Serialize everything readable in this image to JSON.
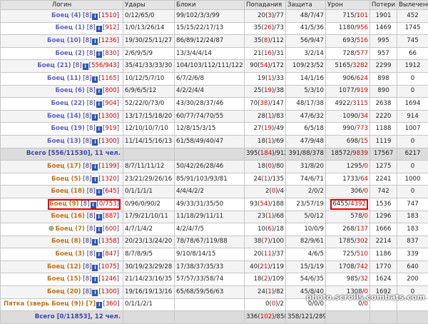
{
  "headers": {
    "login": "Логин",
    "hits": "Удары",
    "blocks": "Блоки",
    "hits_landed": "Попадания",
    "defense": "Защита",
    "damage": "Урон",
    "losses": "Потери",
    "healed": "Вылечено"
  },
  "info_icon": "i",
  "tree_icon": "🜨",
  "watermark": "photo.scrolls.combats.com",
  "rows": [
    {
      "name": "Боец (4)",
      "color": "blue",
      "level": "8",
      "hp": "1510",
      "hits": "0/12/65/0",
      "blocks": "99/102/3/3/99",
      "lp": "20",
      "lr": "3",
      "lt": "77",
      "defense": "48/7/47",
      "dp": "715",
      "dr": "101",
      "losses": "1901",
      "healed": "452"
    },
    {
      "name": "Боец (1)",
      "color": "blue",
      "level": "8",
      "hp": "912",
      "hits": "1/0/13/26/14",
      "blocks": "15/15/22/17/13",
      "lp": "35",
      "lr": "26",
      "lt": "73",
      "defense": "41/5/36",
      "dp": "1180",
      "dr": "956",
      "losses": "1469",
      "healed": "1745"
    },
    {
      "name": "Боец (10)",
      "color": "blue",
      "level": "8",
      "hp": "1236",
      "hits": "19/30/25/11/27",
      "blocks": "86/89/12/24/87",
      "lp": "35",
      "lr": "8",
      "lt": "112",
      "defense": "56/9/47",
      "dp": "693",
      "dr": "516",
      "losses": "995",
      "healed": "745"
    },
    {
      "name": "Боец (2)",
      "color": "blue",
      "level": "8",
      "hp": "830",
      "hits": "2/6/9/5/9",
      "blocks": "13/3/4/4/14",
      "lp": "21",
      "lr": "16",
      "lt": "31",
      "defense": "3/2/14",
      "dp": "728",
      "dr": "577",
      "losses": "957",
      "healed": "66"
    },
    {
      "name": "Боец (21)",
      "color": "blue",
      "level": "8",
      "hp": "556/943",
      "hits": "35/41/33/33/30",
      "blocks": "104/103/112/111/122",
      "lp": "90",
      "lr": "54",
      "lt": "172",
      "defense": "109/23/52",
      "dp": "5165",
      "dr": "3282",
      "losses": "2299",
      "healed": "1912"
    },
    {
      "name": "Боец (11)",
      "color": "blue",
      "level": "8",
      "hp": "1165",
      "hits": "10/12/5/7/10",
      "blocks": "6/7/2/6/8",
      "lp": "19",
      "lr": "1",
      "lt": "33",
      "defense": "14/1/16",
      "dp": "906",
      "dr": "624",
      "losses": "898",
      "healed": "0"
    },
    {
      "name": "Боец (6)",
      "color": "blue",
      "level": "8",
      "hp": "800",
      "hits": "6/9/6/5/12",
      "blocks": "4/2/2/4/4",
      "lp": "25",
      "lr": "19",
      "lt": "38",
      "defense": "5/3/10",
      "dp": "1077",
      "dr": "919",
      "losses": "890",
      "healed": "0"
    },
    {
      "name": "Боец (22)",
      "color": "blue",
      "level": "8",
      "hp": "904",
      "hits": "52/22/0/73/0",
      "blocks": "43/30/28/37/46",
      "lp": "70",
      "lr": "38",
      "lt": "147",
      "defense": "48/17/38",
      "dp": "4922",
      "dr": "3115",
      "losses": "2638",
      "healed": "1694"
    },
    {
      "name": "Боец (14)",
      "color": "blue",
      "level": "8",
      "hp": "1300",
      "hits": "13/17/15/18/20",
      "blocks": "60/77/74/70/55",
      "lp": "28",
      "lr": "1",
      "lt": "83",
      "defense": "47/6/32",
      "dp": "1090",
      "dr": "34",
      "losses": "2220",
      "healed": "914"
    },
    {
      "name": "Боец (19)",
      "color": "blue",
      "level": "8",
      "hp": "919",
      "hits": "12/10/10/7/10",
      "blocks": "12/8/15/3/15",
      "lp": "27",
      "lr": "19",
      "lt": "49",
      "defense": "6/5/18",
      "dp": "990",
      "dr": "773",
      "losses": "1188",
      "healed": "1007"
    },
    {
      "name": "Боец (13)",
      "color": "blue",
      "level": "8",
      "hp": "1300",
      "hits": "11/14/15/16/13",
      "blocks": "61/58/49/40/47",
      "lp": "18",
      "lr": "1",
      "lt": "69",
      "defense": "47/9/48",
      "dp": "698",
      "dr": "15",
      "losses": "1119",
      "healed": "0"
    }
  ],
  "total1": {
    "label": "Всего [556/11530], 11 чел.",
    "lp": "395",
    "lr": "184",
    "lt": "912",
    "defense": "391/88/378",
    "dp": "18572",
    "dr": "9839",
    "losses": "17567",
    "healed": "6217"
  },
  "rows2": [
    {
      "name": "Боец (17)",
      "color": "orange",
      "level": "8",
      "hp": "1199",
      "hits": "8/7/11/11/12",
      "blocks": "50/42/26/28/46",
      "lp": "18",
      "lr": "0",
      "lt": "80",
      "defense": "31/8/20",
      "dp": "1295",
      "dr": "0",
      "losses": "1275",
      "healed": "0"
    },
    {
      "name": "Боец (5)",
      "color": "orange",
      "level": "8",
      "hp": "1320",
      "hits": "23/21/29/26/16",
      "blocks": "85/91/103/93/81",
      "lp": "24",
      "lr": "1",
      "lt": "135",
      "defense": "74/6/71",
      "dp": "1733",
      "dr": "64",
      "losses": "2241",
      "healed": "1000"
    },
    {
      "name": "Боец (18)",
      "color": "orange",
      "level": "8",
      "hp": "645",
      "hits": "0/1/1/1/1",
      "blocks": "4/4/4/2/2",
      "lp": "2",
      "lr": "0",
      "lt": "4",
      "defense": "2/0/2",
      "dp": "306",
      "dr": "0",
      "losses": "742",
      "healed": "0"
    },
    {
      "name": "Боец (9)",
      "color": "orange",
      "level": "8",
      "hp": "0/753",
      "hits": "0/96/0/90/2",
      "blocks": "49/33/31/35/50",
      "lp": "93",
      "lr": "54",
      "lt": "188",
      "defense": "23/57/19",
      "dp": "6455",
      "dr": "4392",
      "losses": "1536",
      "healed": "747",
      "hl": true
    },
    {
      "name": "Боец (16)",
      "color": "orange",
      "level": "8",
      "hp": "887",
      "hits": "17/9/21/10/11",
      "blocks": "11/18/29/11/11",
      "lp": "23",
      "lr": "1",
      "lt": "68",
      "defense": "5/0/12",
      "dp": "578",
      "dr": "0",
      "losses": "1296",
      "healed": "183"
    },
    {
      "name": "Боец (7)",
      "color": "orange",
      "level": "8",
      "hp": "600",
      "hits": "4/7/1/4/2",
      "blocks": "4/2/4/7/5",
      "lp": "10",
      "lr": "6",
      "lt": "18",
      "defense": "10/0/9",
      "dp": "268",
      "dr": "137",
      "losses": "1666",
      "healed": "183",
      "tree": true
    },
    {
      "name": "Боец (8)",
      "color": "orange",
      "level": "8",
      "hp": "1358",
      "hits": "20/23/13/24/20",
      "blocks": "78/78/67/119/88",
      "lp": "38",
      "lr": "7",
      "lt": "100",
      "defense": "82/9/61",
      "dp": "1785",
      "dr": "302",
      "losses": "2214",
      "healed": "837"
    },
    {
      "name": "Боец (3)",
      "color": "orange",
      "level": "8",
      "hp": "847",
      "hits": "8/7/8/9/5",
      "blocks": "9/10/8/14/15",
      "lp": "20",
      "lr": "11",
      "lt": "37",
      "defense": "4/6/5",
      "dp": "725",
      "dr": "510",
      "losses": "1186",
      "healed": "339"
    },
    {
      "name": "Боец (12)",
      "color": "orange",
      "level": "8",
      "hp": "1075",
      "hits": "30/19/23/29/28",
      "blocks": "17/38/37/35/33",
      "lp": "40",
      "lr": "21",
      "lt": "119",
      "defense": "15/1/19",
      "dp": "1708",
      "dr": "742",
      "losses": "1770",
      "healed": "640"
    },
    {
      "name": "Боец (15)",
      "color": "orange",
      "level": "8",
      "hp": "1246",
      "hits": "21/14/23/16/35",
      "blocks": "57/57/33/58/74",
      "lp": "18",
      "lr": "2",
      "lt": "109",
      "defense": "54/6/35",
      "dp": "985",
      "dr": "32",
      "losses": "1624",
      "healed": "200"
    },
    {
      "name": "Боец (20)",
      "color": "orange",
      "level": "8",
      "hp": "1300",
      "hits": "19/16/19/13/16",
      "blocks": "65/68/59/56/63",
      "lp": "24",
      "lr": "1",
      "lt": "82",
      "defense": "45/8/40",
      "dp": "1308",
      "dr": "0",
      "losses": "1692",
      "healed": "0"
    },
    {
      "name": "Пятка (зверь Боец (9)) [7]",
      "color": "orange",
      "level": "",
      "hp": "360",
      "hits": "0/1/1/2/1",
      "blocks": "",
      "lp": "0",
      "lr": "0",
      "lt": "2",
      "defense": "0/0/0",
      "dp": "0",
      "dr": "0",
      "losses": "",
      "healed": "",
      "pet": true
    }
  ],
  "total2": {
    "label": "Всего [0/11853], 12 чел.",
    "lp": "336",
    "lr": "102",
    "lt": "858",
    "defense": "358/121/289",
    "dp": "",
    "dr": "",
    "losses": "",
    "healed": ""
  }
}
